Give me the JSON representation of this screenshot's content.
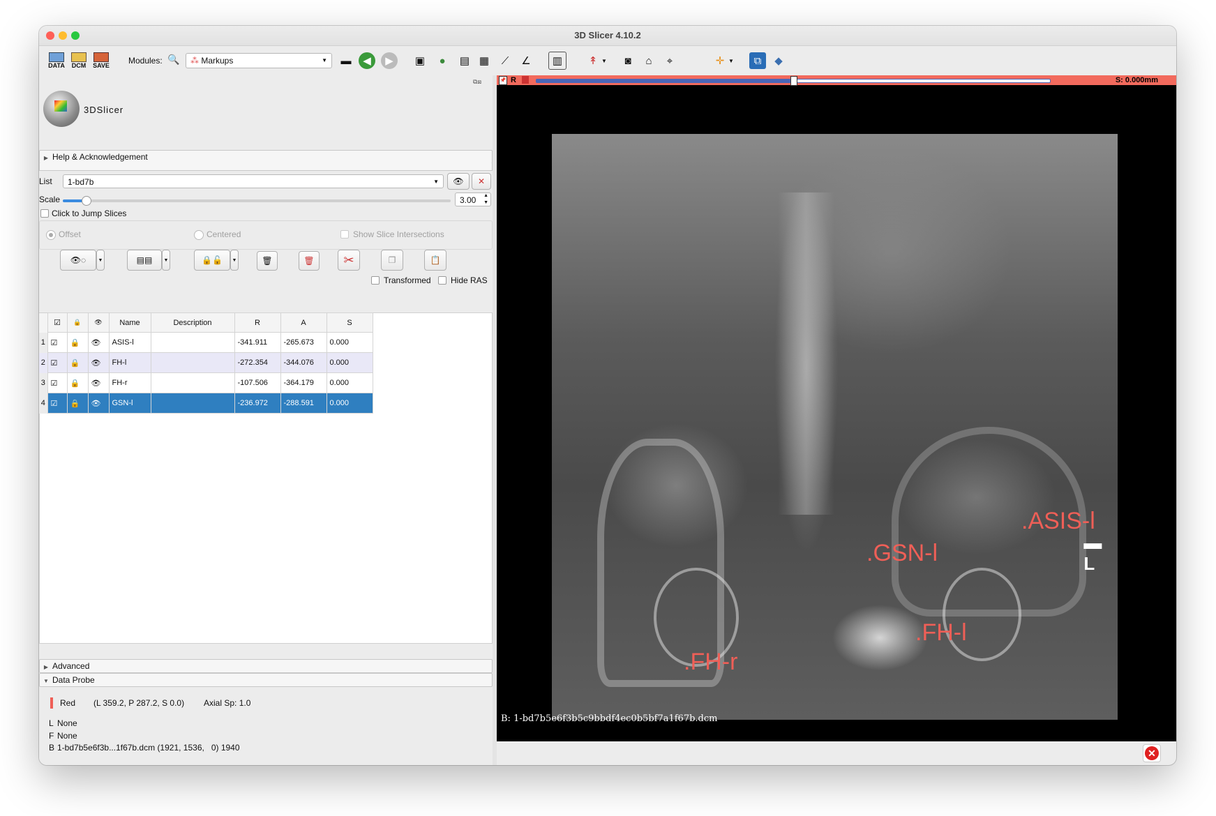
{
  "window": {
    "title": "3D Slicer 4.10.2"
  },
  "toolbar": {
    "data_label": "DATA",
    "dcm_label": "DCM",
    "save_label": "SAVE",
    "modules_label": "Modules:",
    "module_selected": "Markups"
  },
  "module_panel": {
    "logo_text": "3DSlicer",
    "help_section": "Help & Acknowledgement",
    "list_label": "List",
    "list_value": "1-bd7b",
    "scale_label": "Scale",
    "scale_value": "3.00",
    "scale_fraction": 0.06,
    "click_to_jump": "Click to Jump Slices",
    "offset_label": "Offset",
    "centered_label": "Centered",
    "show_intersections_label": "Show Slice Intersections",
    "transformed_label": "Transformed",
    "hide_ras_label": "Hide RAS",
    "advanced_section": "Advanced",
    "data_probe_section": "Data Probe"
  },
  "table": {
    "headers": [
      "Name",
      "Description",
      "R",
      "A",
      "S"
    ],
    "rows": [
      {
        "num": "1",
        "name": "ASIS-l",
        "description": "",
        "r": "-341.911",
        "a": "-265.673",
        "s": "0.000"
      },
      {
        "num": "2",
        "name": "FH-l",
        "description": "",
        "r": "-272.354",
        "a": "-344.076",
        "s": "0.000"
      },
      {
        "num": "3",
        "name": "FH-r",
        "description": "",
        "r": "-107.506",
        "a": "-364.179",
        "s": "0.000"
      },
      {
        "num": "4",
        "name": "GSN-l",
        "description": "",
        "r": "-236.972",
        "a": "-288.591",
        "s": "0.000"
      }
    ]
  },
  "data_probe": {
    "view_name": "Red",
    "coords": "(L 359.2, P 287.2, S 0.0)",
    "axial": "Axial Sp: 1.0",
    "l_label": "L",
    "l_value": "None",
    "f_label": "F",
    "f_value": "None",
    "b_label": "B",
    "b_value": "1-bd7b5e6f3b...1f67b.dcm (1921, 1536,   0) 1940"
  },
  "viewer": {
    "slice_letter": "R",
    "slice_offset": "S: 0.000mm",
    "slider_fraction": 0.5,
    "markers": [
      "ASIS-l",
      "GSN-l",
      "FH-l",
      "FH-r"
    ],
    "caption": "B: 1-bd7b5e6f3b5c9bbdf4ec0b5bf7a1f67b.dcm"
  },
  "colors": {
    "accent_red": "#ef5f57",
    "selection_blue": "#2f7fc0"
  }
}
